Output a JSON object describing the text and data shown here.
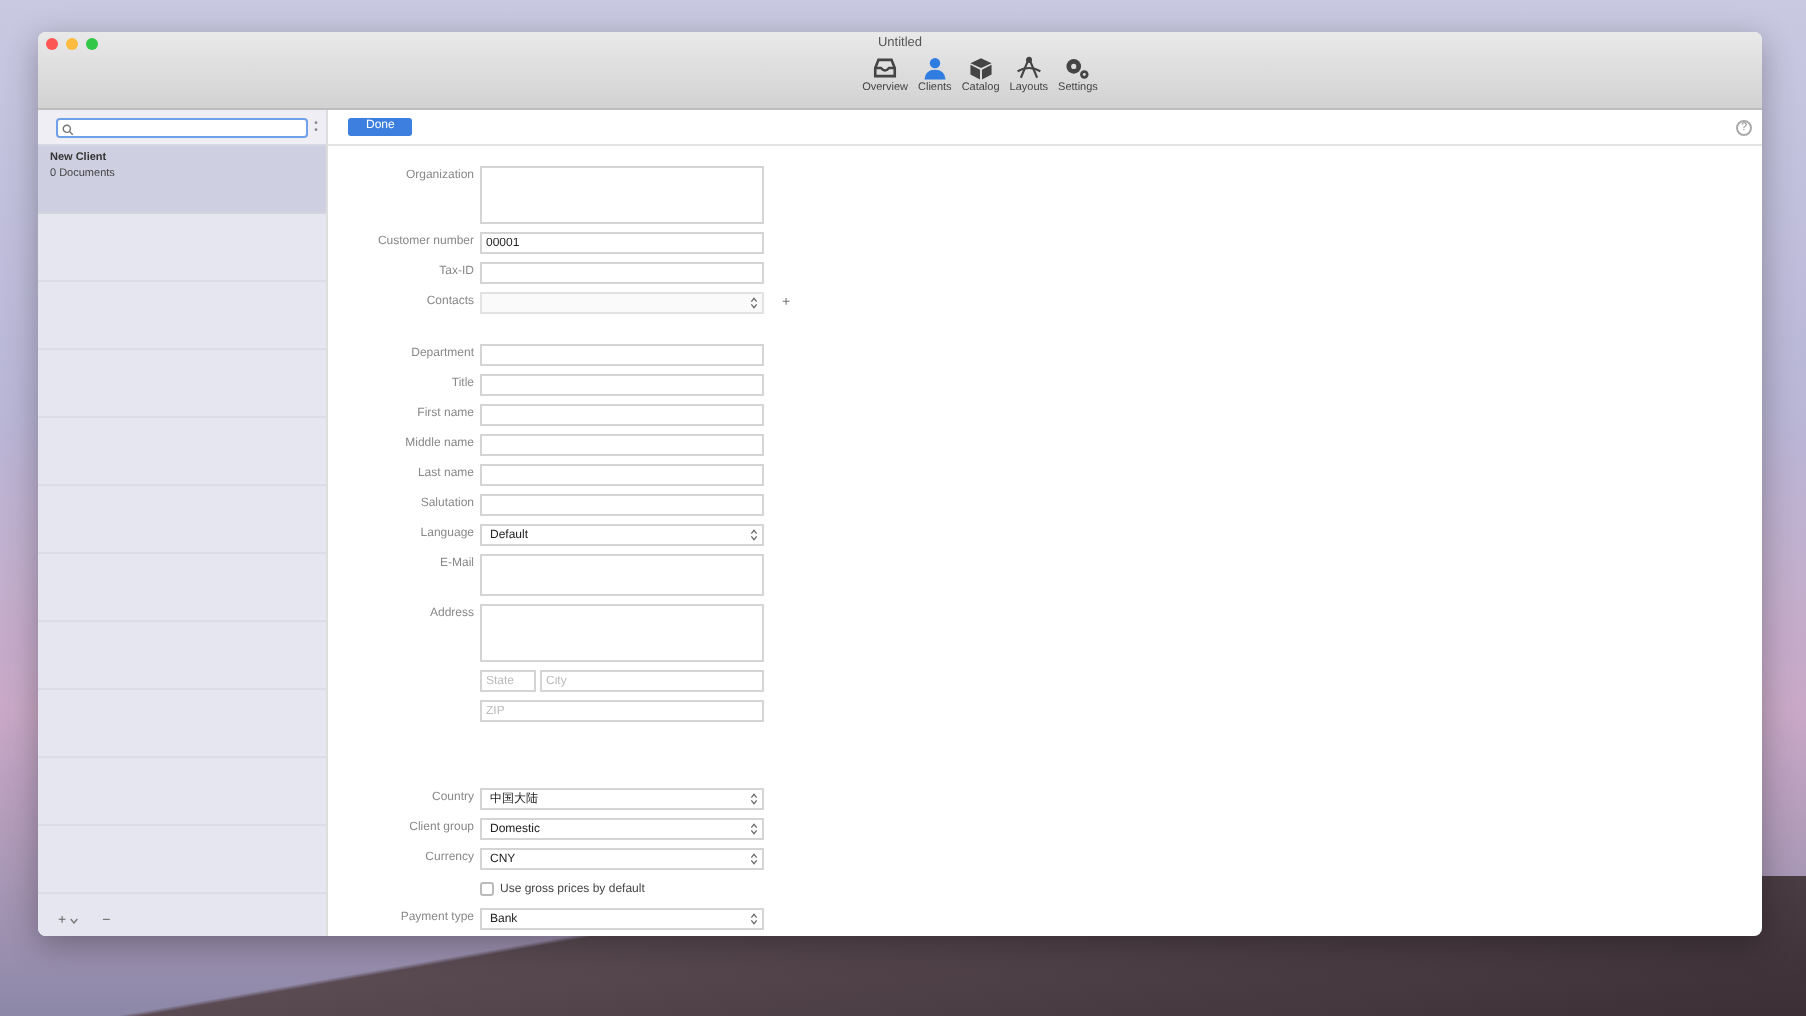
{
  "window": {
    "title": "Untitled"
  },
  "toolbar": [
    {
      "label": "Overview",
      "selected": false
    },
    {
      "label": "Clients",
      "selected": true
    },
    {
      "label": "Catalog",
      "selected": false
    },
    {
      "label": "Layouts",
      "selected": false
    },
    {
      "label": "Settings",
      "selected": false
    }
  ],
  "sidebar": {
    "items": [
      {
        "title": "New Client",
        "subtitle": "0 Documents",
        "selected": true
      }
    ],
    "add_button": "+",
    "remove_button": "−"
  },
  "header": {
    "done_button": "Done",
    "help_button": "?"
  },
  "form": {
    "sections": [
      [
        {
          "kind": "textarea",
          "label": "Organization"
        },
        {
          "kind": "text",
          "label": "Customer number",
          "value": "00001"
        },
        {
          "kind": "text",
          "label": "Tax-ID"
        },
        {
          "kind": "stepper",
          "label": "Contacts",
          "disabled": true,
          "add": "+"
        }
      ],
      [
        {
          "kind": "text",
          "label": "Department"
        },
        {
          "kind": "text",
          "label": "Title"
        },
        {
          "kind": "text",
          "label": "First name"
        },
        {
          "kind": "text",
          "label": "Middle name"
        },
        {
          "kind": "text",
          "label": "Last name"
        },
        {
          "kind": "text",
          "label": "Salutation"
        },
        {
          "kind": "select",
          "label": "Language",
          "value": "Default"
        },
        {
          "kind": "textarea_small",
          "label": "E-Mail"
        },
        {
          "kind": "textarea",
          "label": "Address"
        },
        {
          "kind": "pair",
          "placeholders": [
            "State",
            "City"
          ]
        },
        {
          "kind": "text",
          "placeholder": "ZIP"
        }
      ],
      [
        {
          "kind": "select",
          "label": "Country",
          "value": "中国大陆"
        },
        {
          "kind": "select",
          "label": "Client group",
          "value": "Domestic"
        },
        {
          "kind": "select",
          "label": "Currency",
          "value": "CNY"
        },
        {
          "kind": "checkbox",
          "label": "Use gross prices by default",
          "checked": false
        },
        {
          "kind": "select",
          "label": "Payment type",
          "value": "Bank"
        }
      ]
    ]
  }
}
